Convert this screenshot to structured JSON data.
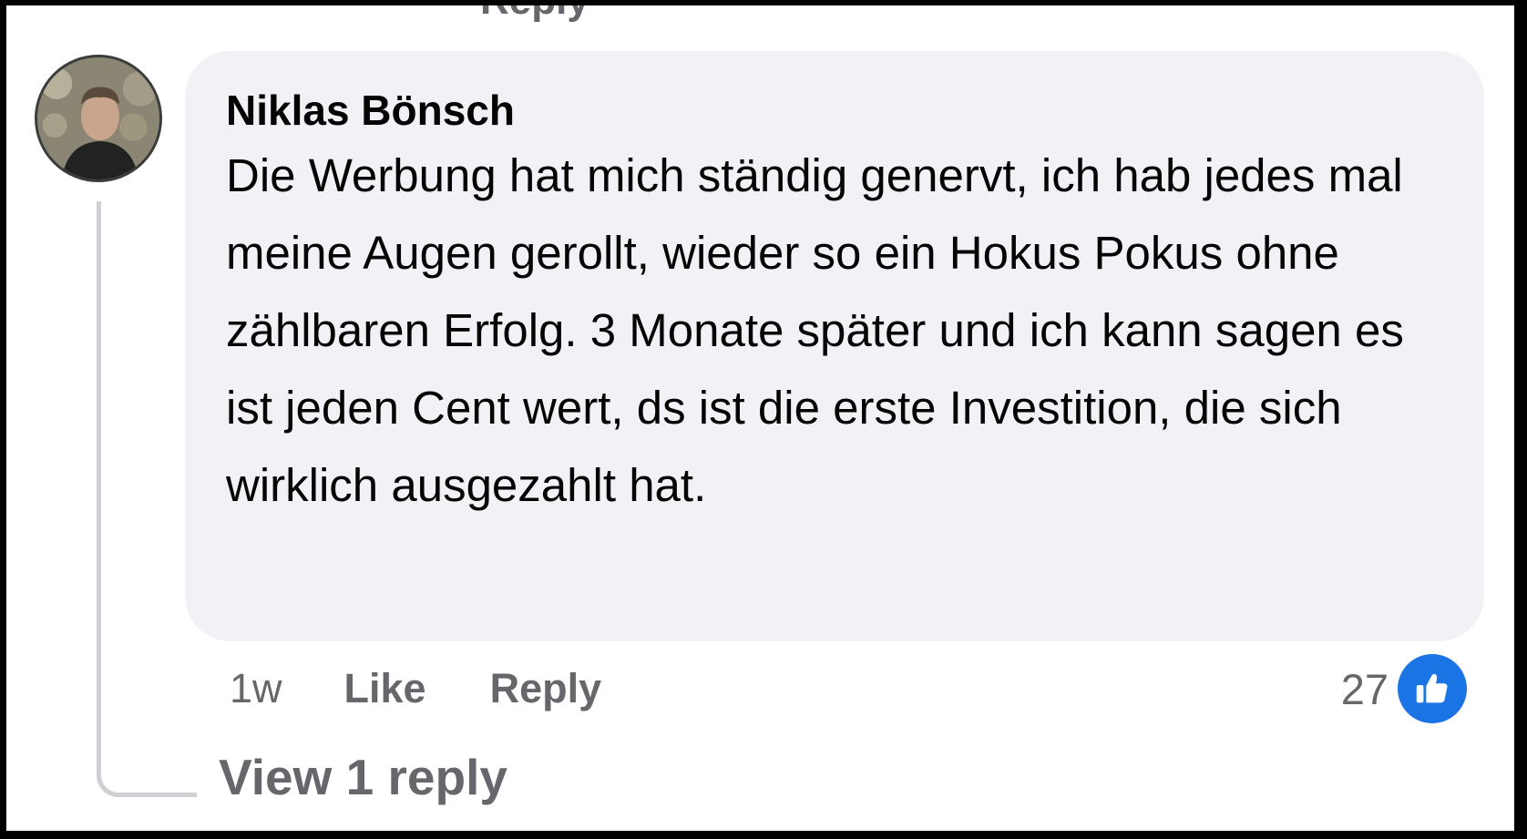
{
  "cutoff_label": "Reply",
  "comment": {
    "author": "Niklas Bönsch",
    "text": "Die Werbung hat mich ständig genervt, ich hab jedes mal meine Augen gerollt, wieder so ein Hokus Pokus ohne zählbaren Erfolg. 3 Monate später und ich kann sagen es ist jeden Cent wert, ds ist die erste Investition, die sich wirklich ausgezahlt hat.",
    "time": "1w",
    "like_label": "Like",
    "reply_label": "Reply",
    "reaction_count": "27",
    "reaction_icon": "thumbs-up-icon",
    "reaction_color": "#1b74e4",
    "bubble_color": "#f0f2f5"
  },
  "view_replies_label": "View 1 reply"
}
